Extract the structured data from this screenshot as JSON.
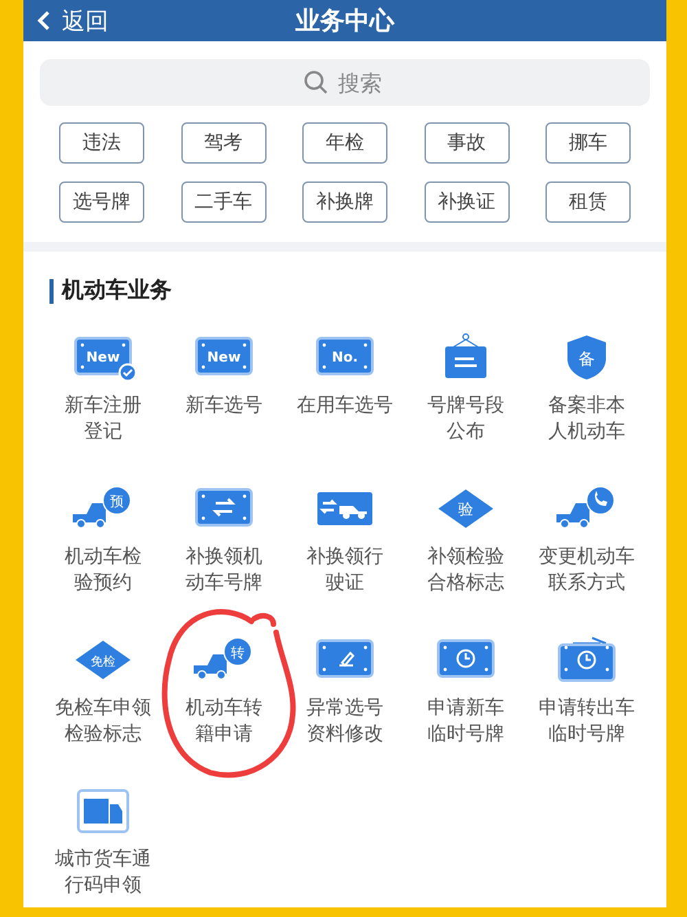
{
  "header": {
    "back": "返回",
    "title": "业务中心"
  },
  "search": {
    "placeholder": "搜索"
  },
  "tags": [
    "违法",
    "驾考",
    "年检",
    "事故",
    "挪车",
    "选号牌",
    "二手车",
    "补换牌",
    "补换证",
    "租赁"
  ],
  "section": {
    "title": "机动车业务"
  },
  "services": [
    {
      "kind": "plate",
      "icon_text": "New",
      "badge": true,
      "label_lines": [
        "新车注册",
        "登记"
      ],
      "circled": false
    },
    {
      "kind": "plate",
      "icon_text": "New",
      "badge": false,
      "label_lines": [
        "新车选号"
      ],
      "circled": false
    },
    {
      "kind": "plate",
      "icon_text": "No.",
      "badge": false,
      "label_lines": [
        "在用车选号"
      ],
      "circled": false
    },
    {
      "kind": "sign",
      "label_lines": [
        "号牌号段",
        "公布"
      ],
      "circled": false
    },
    {
      "kind": "shield",
      "icon_text": "备",
      "label_lines": [
        "备案非本",
        "人机动车"
      ],
      "circled": false
    },
    {
      "kind": "truck",
      "icon_text": "预",
      "label_lines": [
        "机动车检",
        "验预约"
      ],
      "circled": false
    },
    {
      "kind": "plate-arrows",
      "label_lines": [
        "补换领机",
        "动车号牌"
      ],
      "circled": false
    },
    {
      "kind": "car-swap",
      "label_lines": [
        "补换领行",
        "驶证"
      ],
      "circled": false
    },
    {
      "kind": "diamond",
      "icon_text": "验",
      "label_lines": [
        "补领检验",
        "合格标志"
      ],
      "circled": false
    },
    {
      "kind": "truck-phone",
      "label_lines": [
        "变更机动车",
        "联系方式"
      ],
      "circled": false
    },
    {
      "kind": "diamond",
      "icon_text": "免检",
      "label_lines": [
        "免检车申领",
        "检验标志"
      ],
      "circled": false
    },
    {
      "kind": "truck",
      "icon_text": "转",
      "label_lines": [
        "机动车转",
        "籍申请"
      ],
      "circled": true
    },
    {
      "kind": "plate-pen",
      "label_lines": [
        "异常选号",
        "资料修改"
      ],
      "circled": false
    },
    {
      "kind": "plate-clock",
      "label_lines": [
        "申请新车",
        "临时号牌"
      ],
      "circled": false
    },
    {
      "kind": "plate-clock-flag",
      "label_lines": [
        "申请转出车",
        "临时号牌"
      ],
      "circled": false
    },
    {
      "kind": "lorry",
      "label_lines": [
        "城市货车通",
        "行码申领"
      ],
      "circled": false
    }
  ]
}
